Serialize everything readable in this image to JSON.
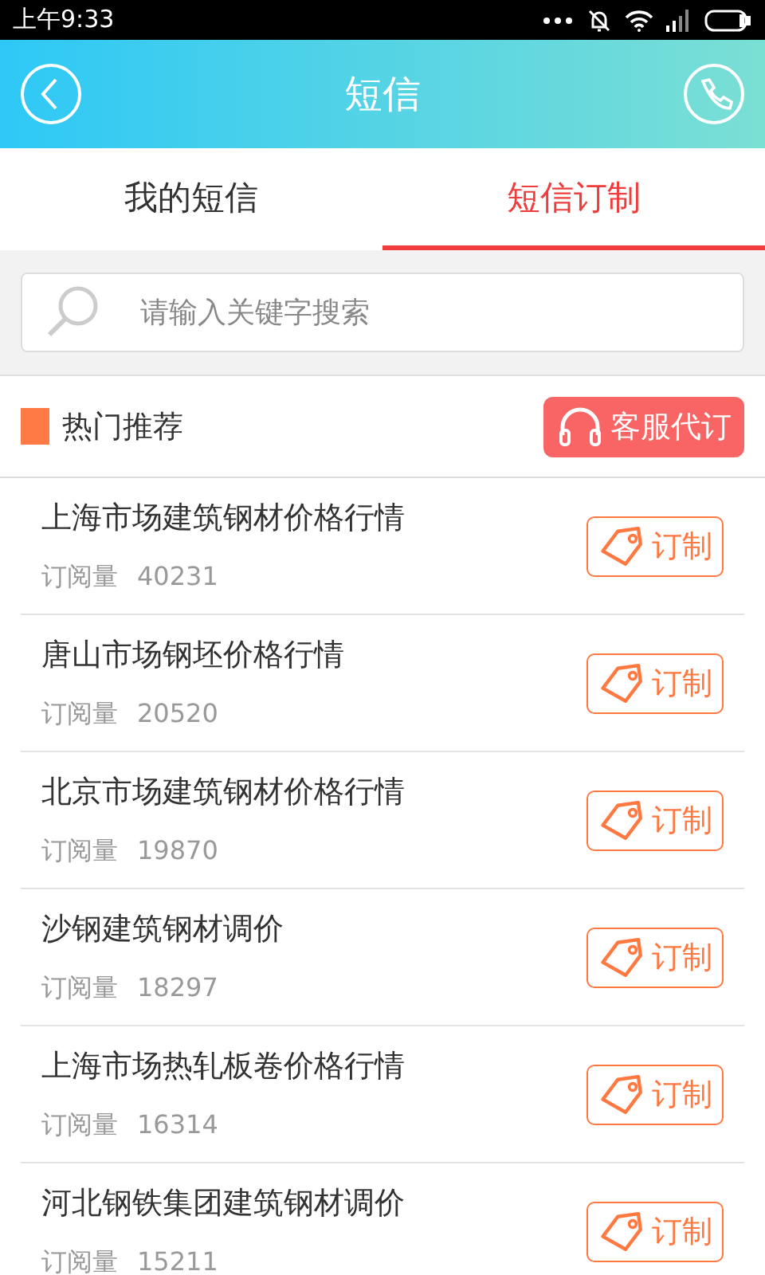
{
  "status_bar": {
    "time": "上午9:33"
  },
  "header": {
    "title": "短信"
  },
  "tabs": [
    {
      "label": "我的短信",
      "selected": false
    },
    {
      "label": "短信订制",
      "selected": true
    }
  ],
  "search": {
    "placeholder": "请输入关键字搜索"
  },
  "section": {
    "title": "热门推荐",
    "service_button": "客服代订"
  },
  "items": [
    {
      "title": "上海市场建筑钢材价格行情",
      "count_label": "订阅量",
      "count": "40231",
      "button": "订制"
    },
    {
      "title": "唐山市场钢坯价格行情",
      "count_label": "订阅量",
      "count": "20520",
      "button": "订制"
    },
    {
      "title": "北京市场建筑钢材价格行情",
      "count_label": "订阅量",
      "count": "19870",
      "button": "订制"
    },
    {
      "title": "沙钢建筑钢材调价",
      "count_label": "订阅量",
      "count": "18297",
      "button": "订制"
    },
    {
      "title": "上海市场热轧板卷价格行情",
      "count_label": "订阅量",
      "count": "16314",
      "button": "订制"
    },
    {
      "title": "河北钢铁集团建筑钢材调价",
      "count_label": "订阅量",
      "count": "15211",
      "button": "订制"
    }
  ]
}
